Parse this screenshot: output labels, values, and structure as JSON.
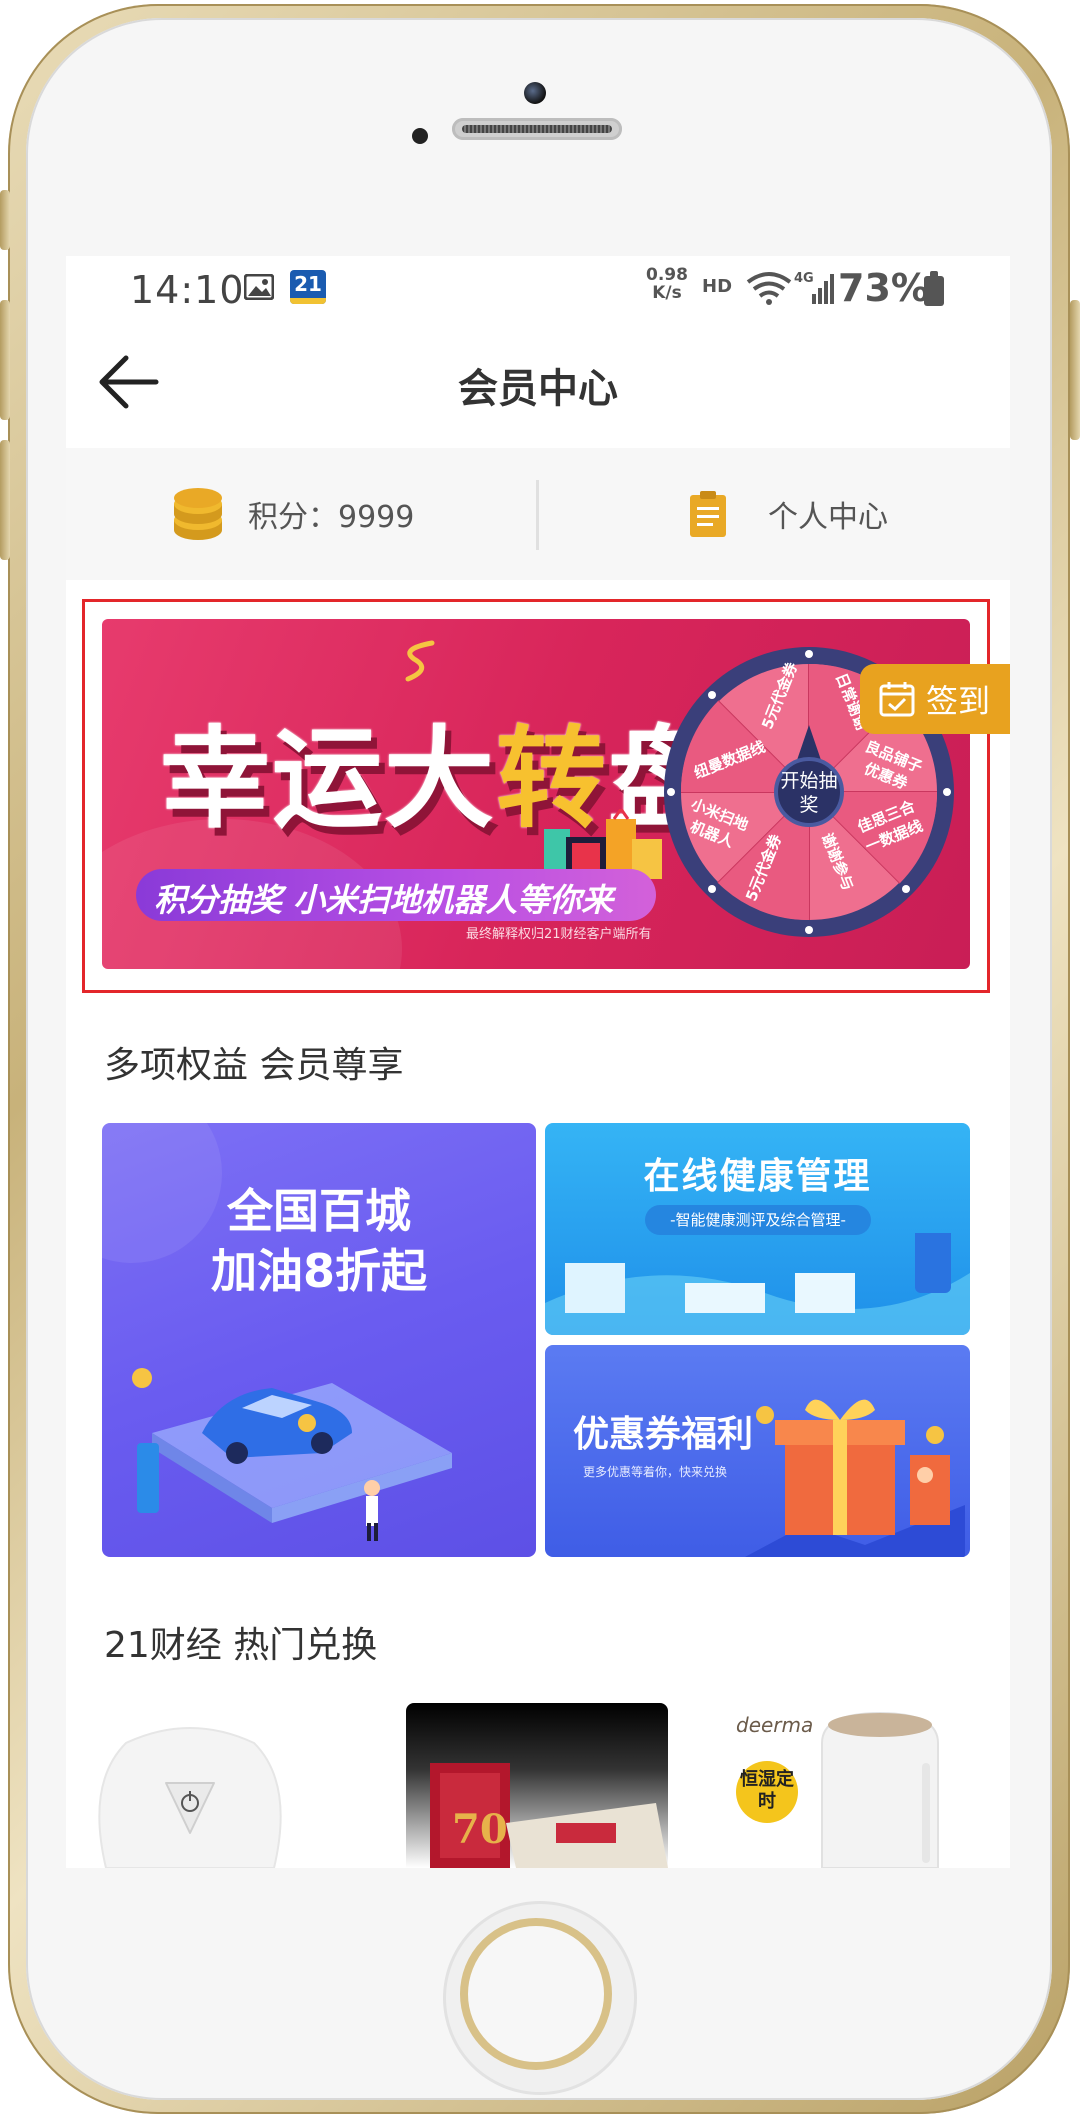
{
  "status_bar": {
    "time": "14:10",
    "app_badge": "21",
    "net_speed_value": "0.98",
    "net_speed_unit": "K/s",
    "hd": "HD",
    "network_type": "4G",
    "battery_percent": "73%"
  },
  "nav": {
    "title": "会员中心",
    "back_icon": "back-arrow-icon"
  },
  "info_bar": {
    "points_label": "积分：9999",
    "personal_center_label": "个人中心"
  },
  "banner": {
    "title_part1": "幸运大",
    "title_part2": "转",
    "title_part3": "盘",
    "subtitle": "积分抽奖  小米扫地机器人等你来",
    "note": "最终解释权归21财经客户端所有",
    "wheel_center": "开始抽奖",
    "wheel_segments": [
      "5元代金券",
      "日常谢谢",
      "良品铺子优惠券",
      "佳思三合一数据线",
      "谢谢参与",
      "5元代金券",
      "小米扫地机器人",
      "纽曼数据线"
    ]
  },
  "signin": {
    "label": "签到"
  },
  "benefits": {
    "section_title": "多项权益 会员尊享",
    "card_fuel_line1": "全国百城",
    "card_fuel_line2": "加油8折起",
    "card_health_title": "在线健康管理",
    "card_health_sub": "-智能健康测评及综合管理-",
    "card_coupon_title": "优惠券福利",
    "card_coupon_sub": "更多优惠等着你，快来兑换"
  },
  "hot": {
    "section_title": "21财经 热门兑换",
    "product3_brand": "deerma",
    "product3_badge": "恒湿定时"
  },
  "colors": {
    "accent_orange": "#e8a21f",
    "banner_pink": "#d8255a",
    "selection_red": "#e3262a"
  }
}
